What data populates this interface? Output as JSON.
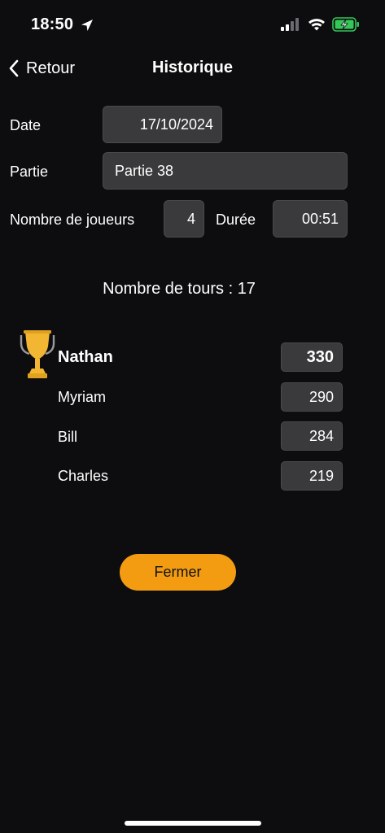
{
  "status_bar": {
    "time": "18:50",
    "icons": [
      "location-arrow-icon",
      "signal-icon",
      "wifi-icon",
      "battery-charging-icon"
    ]
  },
  "nav": {
    "back_label": "Retour",
    "title": "Historique"
  },
  "form": {
    "date_label": "Date",
    "date_value": "17/10/2024",
    "partie_label": "Partie",
    "partie_value": "Partie 38",
    "players_label": "Nombre de joueurs",
    "players_value": "4",
    "duration_label": "Durée",
    "duration_value": "00:51"
  },
  "tours_text": "Nombre de tours : 17",
  "players": [
    {
      "name": "Nathan",
      "score": "330",
      "winner": true
    },
    {
      "name": "Myriam",
      "score": "290",
      "winner": false
    },
    {
      "name": "Bill",
      "score": "284",
      "winner": false
    },
    {
      "name": "Charles",
      "score": "219",
      "winner": false
    }
  ],
  "close_label": "Fermer",
  "colors": {
    "background": "#0d0d10",
    "accent": "#f39c12",
    "field": "#3a3a3c",
    "trophy": "#f2b632",
    "battery": "#34c759"
  }
}
